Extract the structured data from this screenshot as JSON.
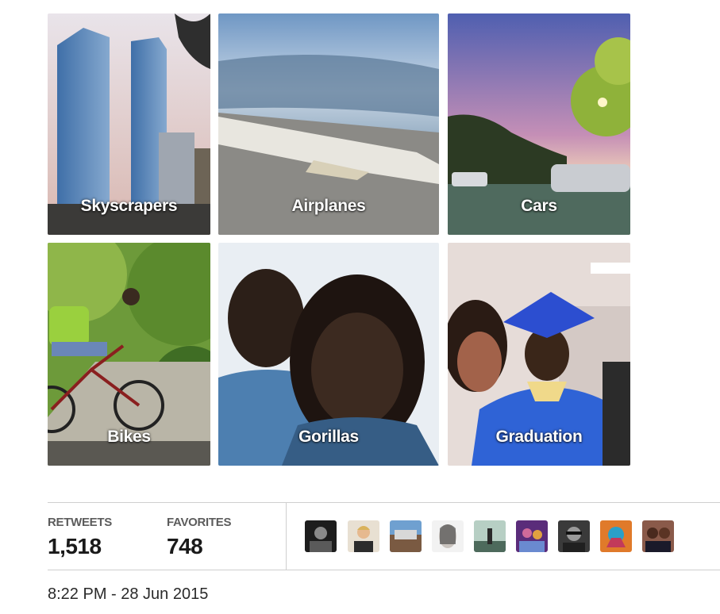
{
  "album": {
    "tiles": [
      {
        "label": "Skyscrapers"
      },
      {
        "label": "Airplanes"
      },
      {
        "label": "Cars"
      },
      {
        "label": "Bikes"
      },
      {
        "label": "Gorillas"
      },
      {
        "label": "Graduation"
      }
    ]
  },
  "stats": {
    "retweets_label": "RETWEETS",
    "retweets_value": "1,518",
    "favorites_label": "FAVORITES",
    "favorites_value": "748"
  },
  "avatars": [
    {
      "icon": "user-avatar-icon"
    },
    {
      "icon": "user-avatar-icon"
    },
    {
      "icon": "user-avatar-icon"
    },
    {
      "icon": "user-avatar-icon"
    },
    {
      "icon": "user-avatar-icon"
    },
    {
      "icon": "user-avatar-icon"
    },
    {
      "icon": "user-avatar-icon"
    },
    {
      "icon": "user-avatar-icon"
    },
    {
      "icon": "user-avatar-icon"
    }
  ],
  "timestamp": "8:22 PM - 28 Jun 2015"
}
